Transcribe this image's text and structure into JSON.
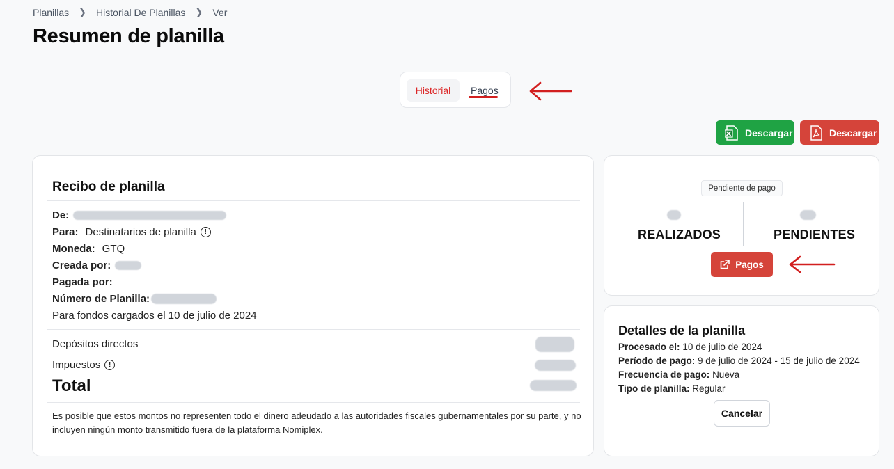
{
  "breadcrumb": {
    "items": [
      "Planillas",
      "Historial De Planillas",
      "Ver"
    ]
  },
  "page": {
    "title": "Resumen de planilla"
  },
  "tabs": {
    "historial": "Historial",
    "pagos": "Pagos"
  },
  "actions": {
    "excel_label": "Descargar",
    "pdf_label": "Descargar"
  },
  "receipt": {
    "title": "Recibo de planilla",
    "de_label": "De:",
    "para_label": "Para:",
    "para_value": "Destinatarios de planilla",
    "moneda_label": "Moneda:",
    "moneda_value": "GTQ",
    "creada_label": "Creada por:",
    "pagada_label": "Pagada por:",
    "numero_label": "Número de Planilla:",
    "fondos_text": "Para fondos cargados el 10 de julio de 2024",
    "depositos_label": "Depósitos directos",
    "impuestos_label": "Impuestos",
    "total_label": "Total",
    "note": "Es posible que estos montos no representen todo el dinero adeudado a las autoridades fiscales gubernamentales por su parte, y no incluyen ningún monto transmitido fuera de la plataforma Nomiplex."
  },
  "status": {
    "badge": "Pendiente de pago",
    "realizados_label": "REALIZADOS",
    "pendientes_label": "PENDIENTES",
    "pagos_button": "Pagos"
  },
  "details": {
    "title": "Detalles de la planilla",
    "procesado_label": "Procesado el:",
    "procesado_value": "10 de julio de 2024",
    "periodo_label": "Período de pago:",
    "periodo_value": "9 de julio de 2024 - 15 de julio de 2024",
    "frecuencia_label": "Frecuencia de pago:",
    "frecuencia_value": "Nueva",
    "tipo_label": "Tipo de planilla:",
    "tipo_value": "Regular",
    "cancel_button": "Cancelar"
  },
  "colors": {
    "brand_red": "#d5443a",
    "excel_green": "#1fa344",
    "annotation_red": "#d21f1f"
  }
}
